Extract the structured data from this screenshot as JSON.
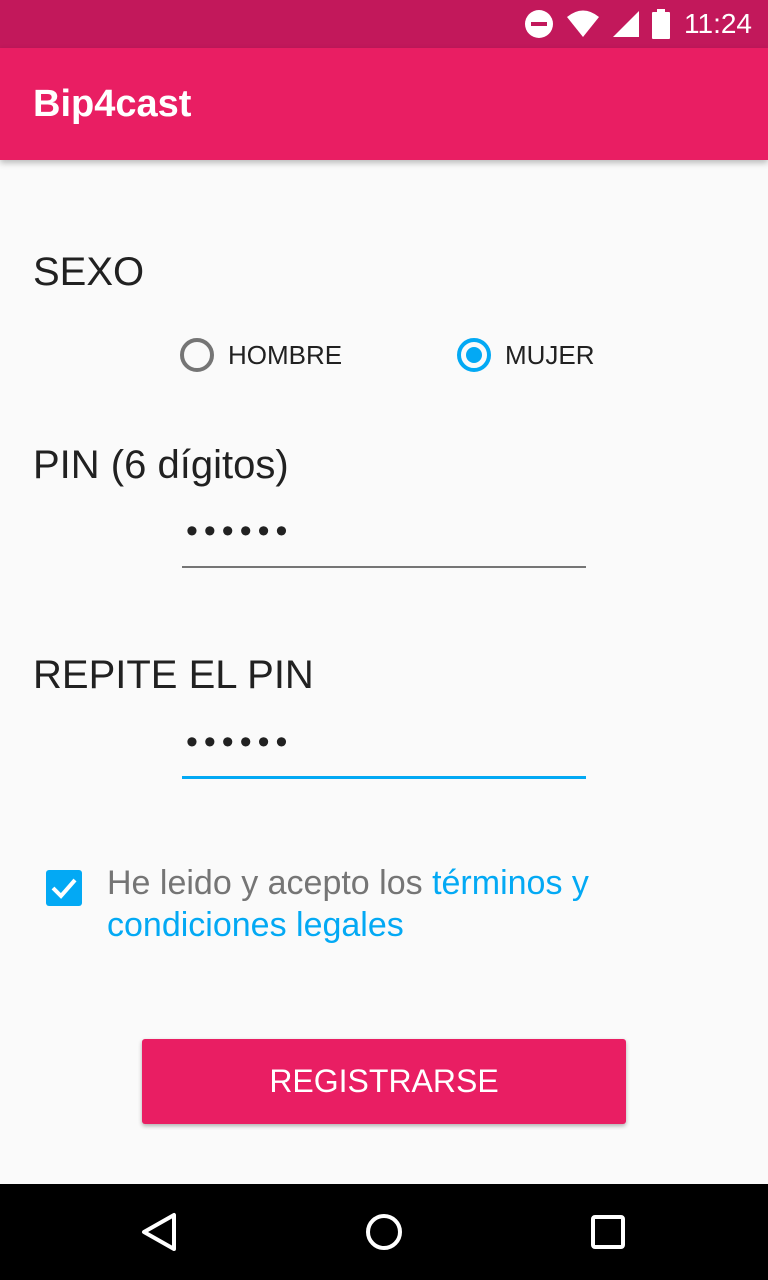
{
  "status_bar": {
    "time": "11:24",
    "icons": [
      "do-not-disturb-icon",
      "wifi-icon",
      "signal-icon",
      "battery-icon"
    ]
  },
  "app_bar": {
    "title": "Bip4cast"
  },
  "form": {
    "sexo_label": "SEXO",
    "sexo_options": [
      {
        "label": "HOMBRE",
        "checked": false
      },
      {
        "label": "MUJER",
        "checked": true
      }
    ],
    "pin_label": "PIN (6 dígitos)",
    "pin_value": "••••••",
    "repeat_pin_label": "REPITE EL PIN",
    "repeat_pin_value": "••••••",
    "terms": {
      "checked": true,
      "text": "He leido y acepto los ",
      "link_text": "términos y condiciones legales"
    },
    "register_button": "REGISTRARSE"
  },
  "nav_bar": {
    "buttons": [
      "back-icon",
      "home-icon",
      "recents-icon"
    ]
  },
  "colors": {
    "status_bar": "#c2185b",
    "primary": "#e91e63",
    "accent": "#03a9f4"
  }
}
